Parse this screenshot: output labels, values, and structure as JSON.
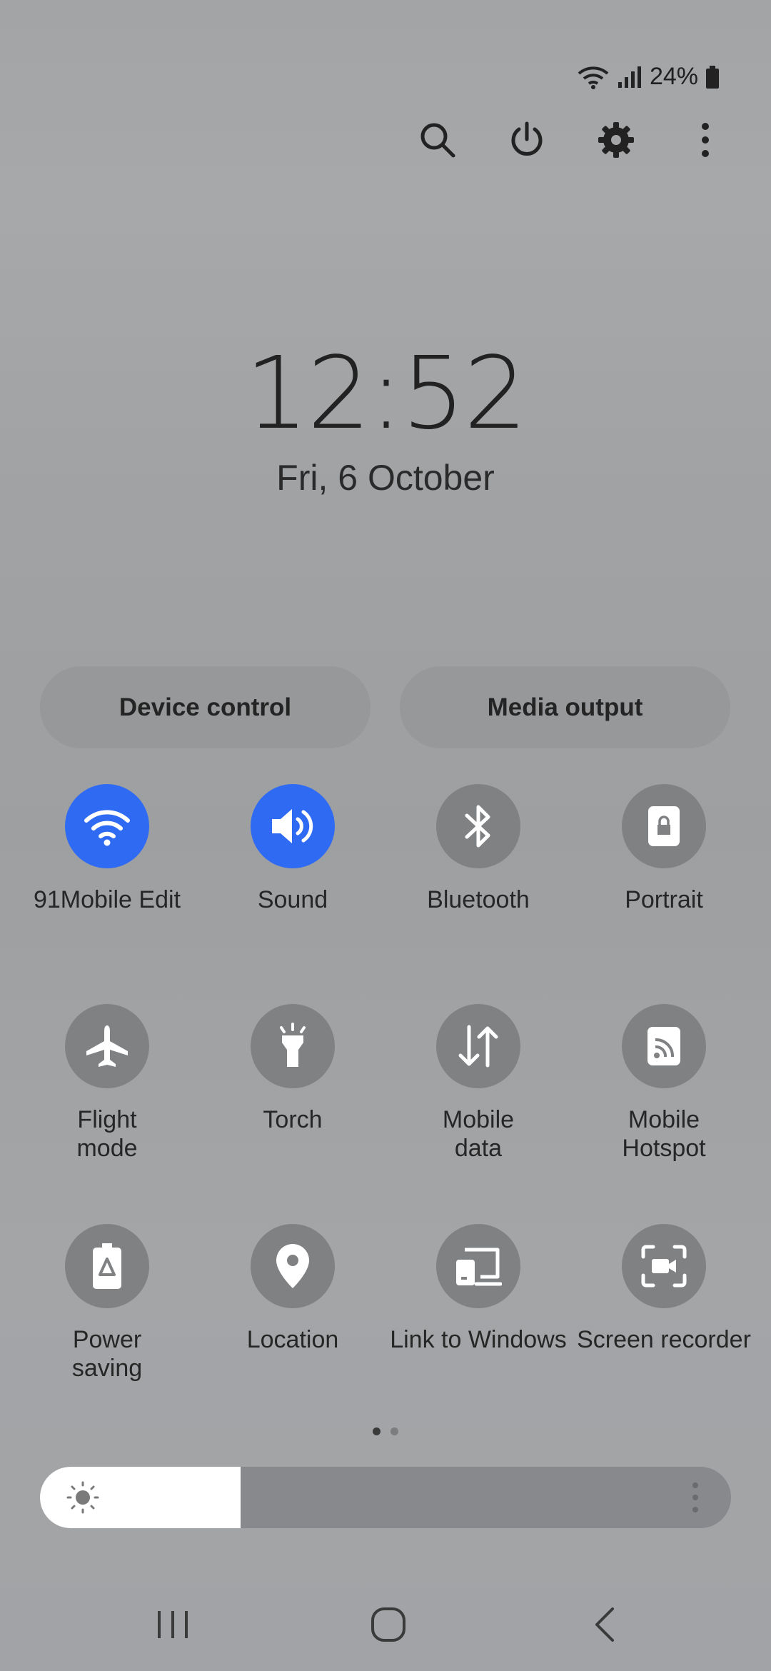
{
  "status": {
    "battery": "24%",
    "icons": [
      "wifi-icon",
      "signal-icon",
      "battery-icon"
    ]
  },
  "top_actions": [
    "search-icon",
    "power-icon",
    "settings-icon",
    "more-options-icon"
  ],
  "clock": {
    "time": "12:52",
    "date": "Fri, 6 October"
  },
  "buttons": {
    "device_control": "Device control",
    "media_output": "Media output"
  },
  "tiles": [
    {
      "label": "91Mobile Edit",
      "icon": "wifi-icon",
      "on": true
    },
    {
      "label": "Sound",
      "icon": "sound-icon",
      "on": true
    },
    {
      "label": "Bluetooth",
      "icon": "bluetooth-icon",
      "on": false
    },
    {
      "label": "Portrait",
      "icon": "portrait-lock-icon",
      "on": false
    },
    {
      "label": "Flight\nmode",
      "icon": "airplane-icon",
      "on": false
    },
    {
      "label": "Torch",
      "icon": "torch-icon",
      "on": false
    },
    {
      "label": "Mobile\ndata",
      "icon": "mobile-data-icon",
      "on": false
    },
    {
      "label": "Mobile\nHotspot",
      "icon": "hotspot-icon",
      "on": false
    },
    {
      "label": "Power\nsaving",
      "icon": "power-saving-icon",
      "on": false
    },
    {
      "label": "Location",
      "icon": "location-icon",
      "on": false
    },
    {
      "label": "Link to Windows",
      "icon": "link-to-windows-icon",
      "on": false
    },
    {
      "label": "Screen recorder",
      "icon": "screen-recorder-icon",
      "on": false
    }
  ],
  "pager": {
    "pages": 2,
    "current": 1
  },
  "brightness": {
    "level": 0.29
  },
  "colors": {
    "accent": "#2f6bf2",
    "tile_off": "#7f8183"
  },
  "nav": [
    "recents-icon",
    "home-icon",
    "back-icon"
  ]
}
